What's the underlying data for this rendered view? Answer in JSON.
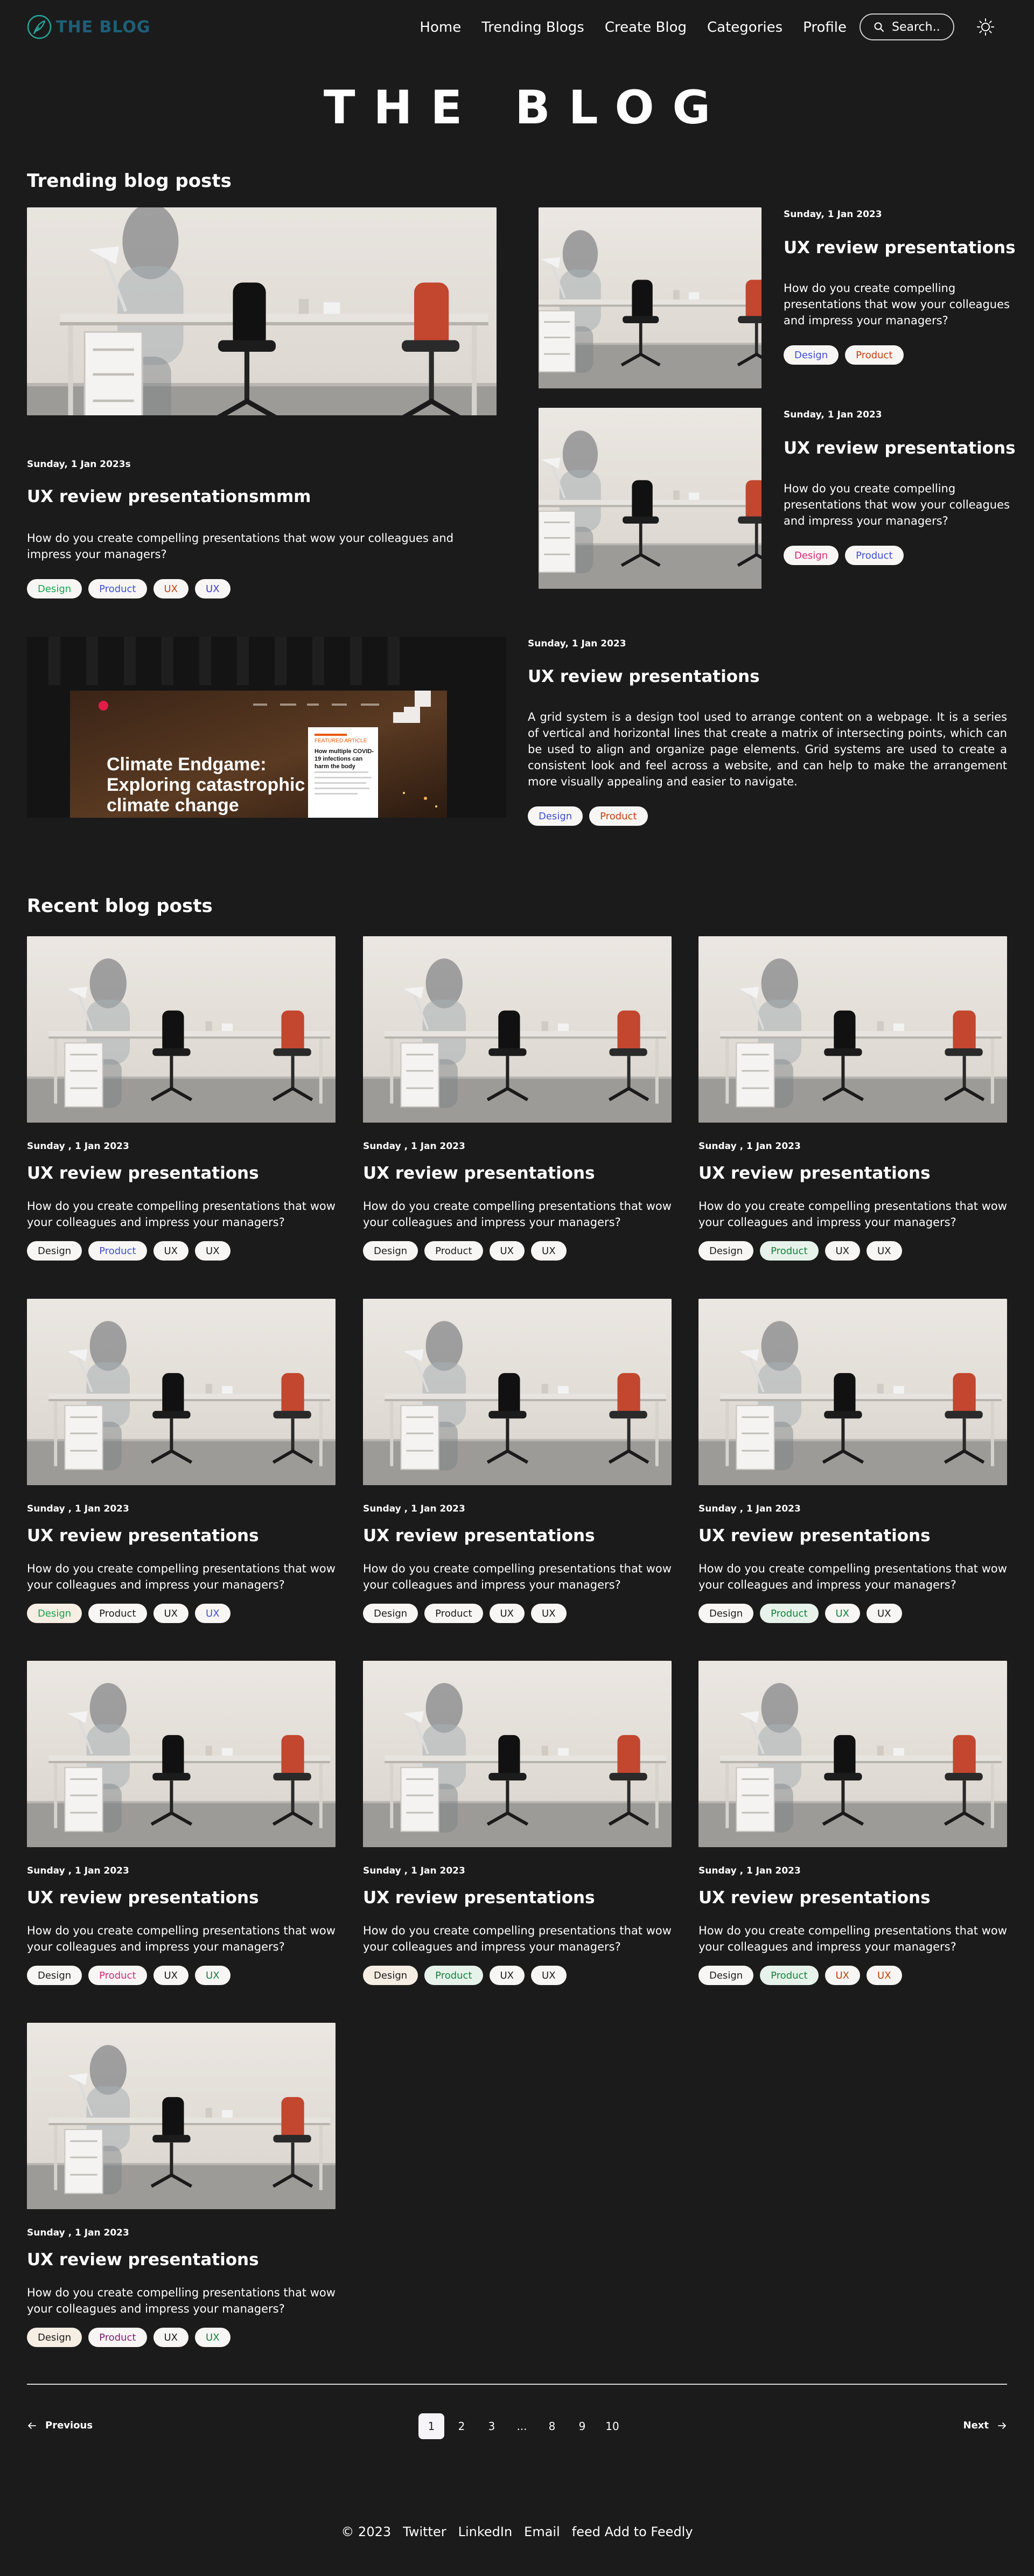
{
  "brand": {
    "name": "THE BLOG"
  },
  "nav": {
    "links": [
      "Home",
      "Trending Blogs",
      "Create Blog",
      "Categories",
      "Profile"
    ],
    "search_placeholder": "Search.."
  },
  "hero": {
    "title": "THE BLOG"
  },
  "trending": {
    "heading": "Trending blog posts",
    "featured": {
      "date": "Sunday, 1 Jan 2023s",
      "title": "UX review presentationsmmm",
      "description": "How do you create compelling presentations that wow your colleagues and impress your managers?",
      "tags": [
        "Design",
        "Product",
        "UX",
        "UX"
      ]
    },
    "side": [
      {
        "date": "Sunday, 1 Jan 2023",
        "title": "UX review presentations",
        "description": "How do you create compelling presentations that wow your colleagues and impress your managers?",
        "tags": [
          "Design",
          "Product"
        ]
      },
      {
        "date": "Sunday, 1 Jan 2023",
        "title": "UX review presentations",
        "description": "How do you create compelling presentations that wow your colleagues and impress your managers?",
        "tags": [
          "Design",
          "Product"
        ]
      }
    ],
    "wide": {
      "date": "Sunday, 1 Jan 2023",
      "title": "UX review presentations",
      "description": "A grid system is a design tool used to arrange content on a webpage. It is a series of vertical and horizontal lines that create a matrix of intersecting points, which can be used to align and organize page elements. Grid systems are used to create a consistent look and feel across a website, and can help to make the arrangement more visually appealing and easier to navigate.",
      "tags": [
        "Design",
        "Product"
      ],
      "thumbnail": {
        "headline": "Climate Endgame: Exploring catastrophic climate change scenarios",
        "card_text": "How multiple COVID-19 infections can harm the body",
        "card_label": "FEATURED ARTICLE"
      }
    }
  },
  "recent": {
    "heading": "Recent blog posts",
    "posts": [
      {
        "date": "Sunday , 1 Jan 2023",
        "title": "UX review presentations",
        "description": "How do you create compelling presentations that wow your colleagues and impress your managers?",
        "tags": [
          "Design",
          "Product",
          "UX",
          "UX"
        ]
      },
      {
        "date": "Sunday , 1 Jan 2023",
        "title": "UX review presentations",
        "description": "How do you create compelling presentations that wow your colleagues and impress your managers?",
        "tags": [
          "Design",
          "Product",
          "UX",
          "UX"
        ]
      },
      {
        "date": "Sunday , 1 Jan 2023",
        "title": "UX review presentations",
        "description": "How do you create compelling presentations that wow your colleagues and impress your managers?",
        "tags": [
          "Design",
          "Product",
          "UX",
          "UX"
        ]
      },
      {
        "date": "Sunday , 1 Jan 2023",
        "title": "UX review presentations",
        "description": "How do you create compelling presentations that wow your colleagues and impress your managers?",
        "tags": [
          "Design",
          "Product",
          "UX",
          "UX"
        ]
      },
      {
        "date": "Sunday , 1 Jan 2023",
        "title": "UX review presentations",
        "description": "How do you create compelling presentations that wow your colleagues and impress your managers?",
        "tags": [
          "Design",
          "Product",
          "UX",
          "UX"
        ]
      },
      {
        "date": "Sunday , 1 Jan 2023",
        "title": "UX review presentations",
        "description": "How do you create compelling presentations that wow your colleagues and impress your managers?",
        "tags": [
          "Design",
          "Product",
          "UX",
          "UX"
        ]
      },
      {
        "date": "Sunday , 1 Jan 2023",
        "title": "UX review presentations",
        "description": "How do you create compelling presentations that wow your colleagues and impress your managers?",
        "tags": [
          "Design",
          "Product",
          "UX",
          "UX"
        ]
      },
      {
        "date": "Sunday , 1 Jan 2023",
        "title": "UX review presentations",
        "description": "How do you create compelling presentations that wow your colleagues and impress your managers?",
        "tags": [
          "Design",
          "Product",
          "UX",
          "UX"
        ]
      },
      {
        "date": "Sunday , 1 Jan 2023",
        "title": "UX review presentations",
        "description": "How do you create compelling presentations that wow your colleagues and impress your managers?",
        "tags": [
          "Design",
          "Product",
          "UX",
          "UX"
        ]
      },
      {
        "date": "Sunday , 1 Jan 2023",
        "title": "UX review presentations",
        "description": "How do you create compelling presentations that wow your colleagues and impress your managers?",
        "tags": [
          "Design",
          "Product",
          "UX",
          "UX"
        ]
      }
    ]
  },
  "pagination": {
    "previous": "Previous",
    "next": "Next",
    "pages": [
      "1",
      "2",
      "3",
      "...",
      "8",
      "9",
      "10"
    ],
    "current": "1"
  },
  "footer": {
    "copyright": "© 2023",
    "links": [
      "Twitter",
      "LinkedIn",
      "Email",
      "feed Add to Feedly"
    ]
  },
  "colors": {
    "background": "#1b1b1b",
    "text": "#ffffff",
    "brand": "#1d5f78",
    "tag_design": "#3f4fd1",
    "tag_product": "#c2410c",
    "tag_ux": "#4338ca"
  },
  "icons": {
    "logo": "feather-logo-icon",
    "search": "search-icon",
    "theme": "sun-icon",
    "prev": "arrow-left-icon",
    "next": "arrow-right-icon"
  }
}
